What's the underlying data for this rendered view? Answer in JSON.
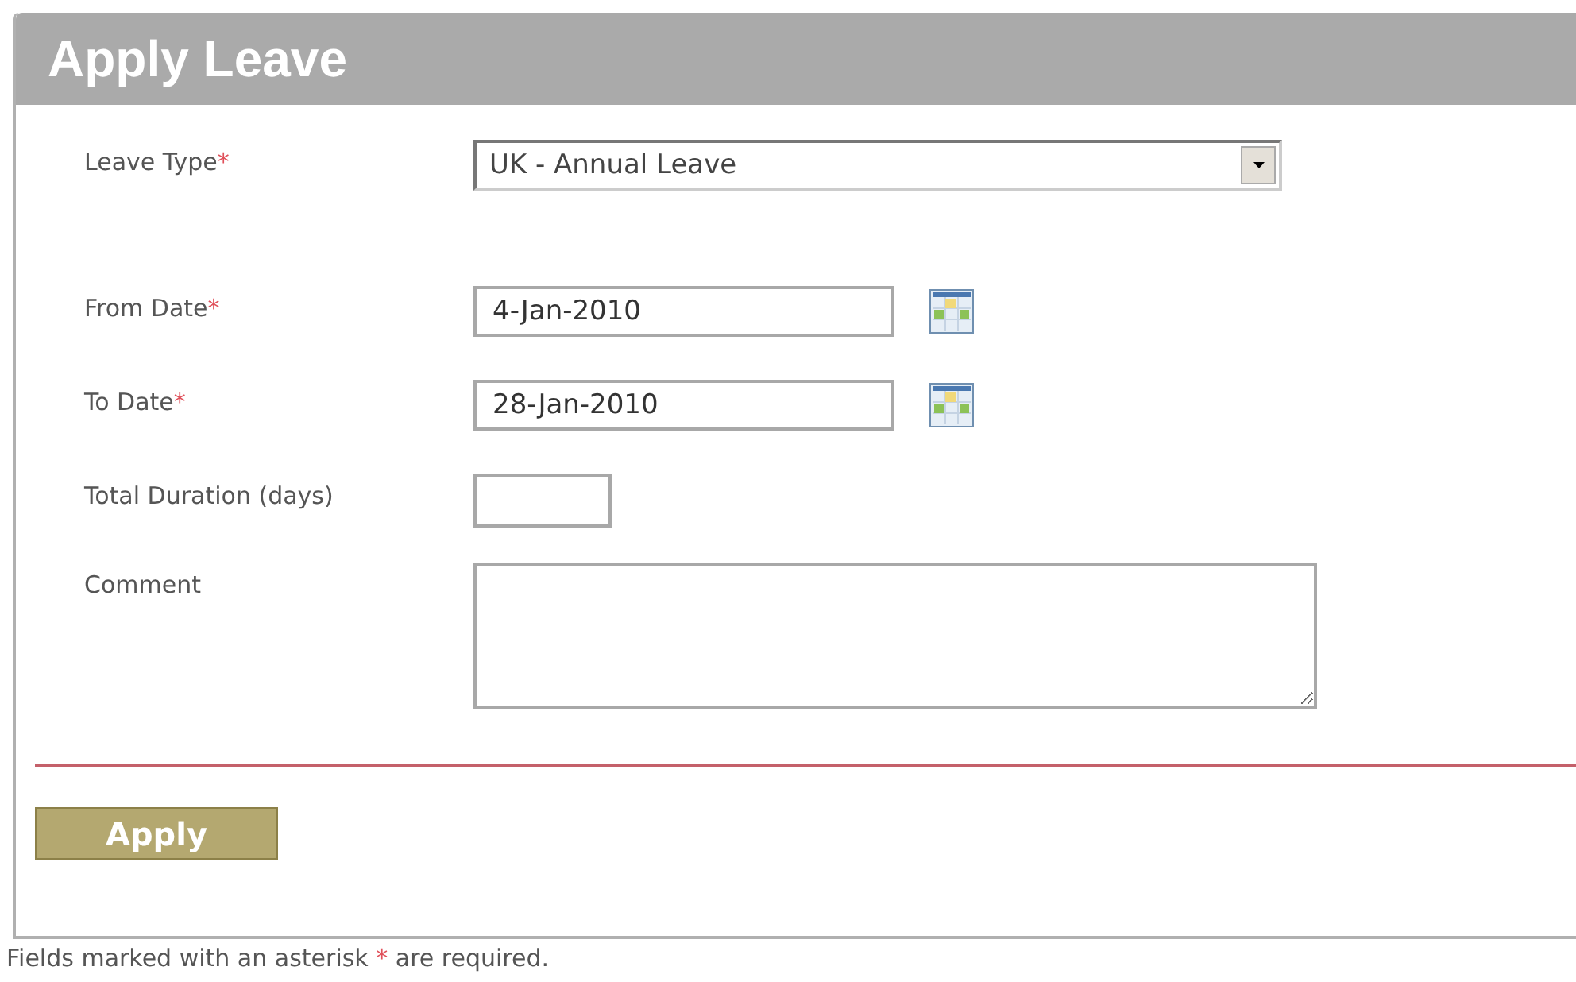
{
  "title": "Apply Leave",
  "fields": [
    {
      "kind": "select",
      "label": "Leave Type",
      "required_mark": "*",
      "value": "UK - Annual Leave"
    },
    {
      "kind": "date",
      "label": "From Date",
      "required_mark": "*",
      "value": "4-Jan-2010"
    },
    {
      "kind": "date",
      "label": "To Date",
      "required_mark": "*",
      "value": "28-Jan-2010"
    },
    {
      "kind": "number",
      "label": "Total Duration (days)"
    },
    {
      "kind": "textarea",
      "label": "Comment"
    }
  ],
  "button": "Apply",
  "note": {
    "before": "Fields marked with an asterisk ",
    "mark": "*",
    "after": " are required."
  }
}
